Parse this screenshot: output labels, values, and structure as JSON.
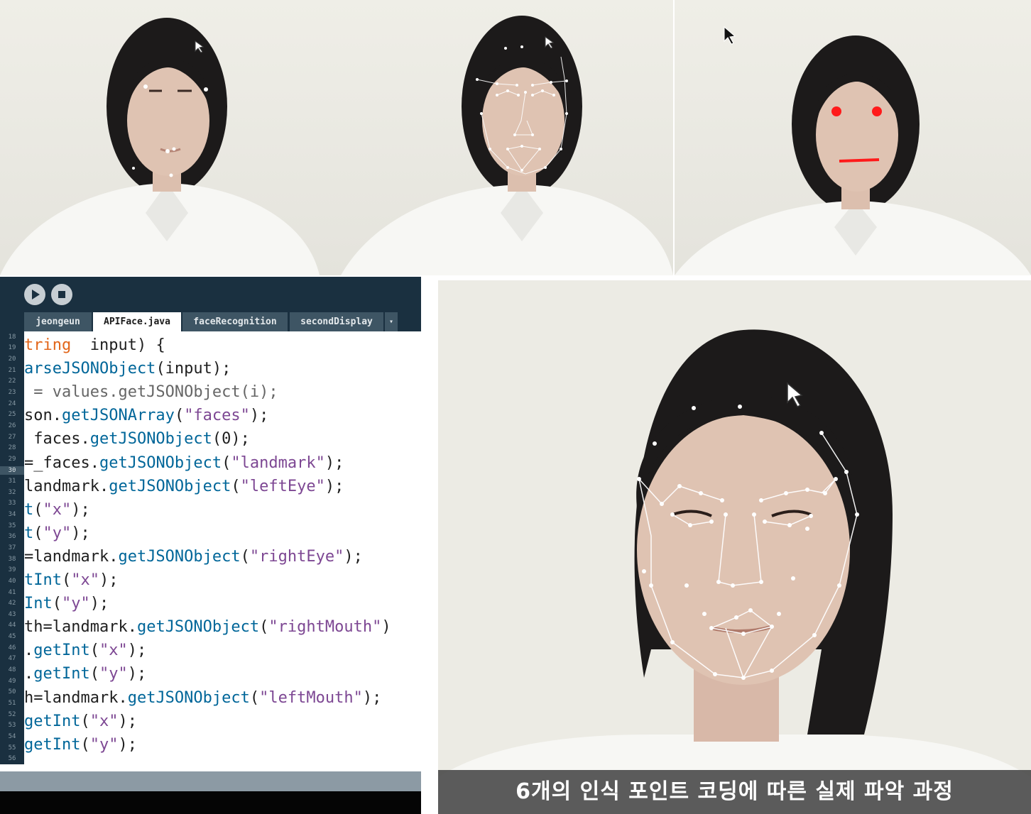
{
  "ide": {
    "toolbar": {
      "run_icon": "play-icon",
      "stop_icon": "stop-icon"
    },
    "tabs": [
      {
        "label": "jeongeun",
        "active": false
      },
      {
        "label": "APIFace.java",
        "active": true
      },
      {
        "label": "faceRecognition",
        "active": false
      },
      {
        "label": "secondDisplay",
        "active": false
      }
    ],
    "tab_menu_glyph": "▾",
    "current_line": 30,
    "line_numbers": [
      "18",
      "19",
      "20",
      "21",
      "22",
      "23",
      "24",
      "25",
      "26",
      "27",
      "28",
      "29",
      "30",
      "31",
      "32",
      "33",
      "34",
      "35",
      "36",
      "37",
      "38",
      "39",
      "40",
      "41",
      "42",
      "43",
      "44",
      "45",
      "46",
      "47",
      "48",
      "49",
      "50",
      "51",
      "52",
      "53",
      "54",
      "55",
      "56"
    ],
    "code": [
      [
        [
          "kw",
          "tring"
        ],
        [
          "",
          "  input) {"
        ]
      ],
      [
        [
          "fn",
          "arseJSONObject"
        ],
        [
          "",
          "(input);"
        ]
      ],
      [
        [
          "dim",
          " = values.getJSONObject(i);"
        ]
      ],
      [
        [
          "",
          "son."
        ],
        [
          "fn",
          "getJSONArray"
        ],
        [
          "",
          "("
        ],
        [
          "str",
          "\"faces\""
        ],
        [
          "",
          ");"
        ]
      ],
      [
        [
          "",
          " faces."
        ],
        [
          "fn",
          "getJSONObject"
        ],
        [
          "",
          "(0);"
        ]
      ],
      [
        [
          "",
          "=_faces."
        ],
        [
          "fn",
          "getJSONObject"
        ],
        [
          "",
          "("
        ],
        [
          "str",
          "\"landmark\""
        ],
        [
          "",
          ");"
        ]
      ],
      [
        [
          "",
          "landmark."
        ],
        [
          "fn",
          "getJSONObject"
        ],
        [
          "",
          "("
        ],
        [
          "str",
          "\"leftEye\""
        ],
        [
          "",
          ");"
        ]
      ],
      [
        [
          "fn",
          "t"
        ],
        [
          "",
          "("
        ],
        [
          "str",
          "\"x\""
        ],
        [
          "",
          ");"
        ]
      ],
      [
        [
          "fn",
          "t"
        ],
        [
          "",
          "("
        ],
        [
          "str",
          "\"y\""
        ],
        [
          "",
          ");"
        ]
      ],
      [
        [
          "",
          "=landmark."
        ],
        [
          "fn",
          "getJSONObject"
        ],
        [
          "",
          "("
        ],
        [
          "str",
          "\"rightEye\""
        ],
        [
          "",
          ");"
        ]
      ],
      [
        [
          "fn",
          "tInt"
        ],
        [
          "",
          "("
        ],
        [
          "str",
          "\"x\""
        ],
        [
          "",
          ");"
        ]
      ],
      [
        [
          "fn",
          "Int"
        ],
        [
          "",
          "("
        ],
        [
          "str",
          "\"y\""
        ],
        [
          "",
          ");"
        ]
      ],
      [
        [
          "",
          "th=landmark."
        ],
        [
          "fn",
          "getJSONObject"
        ],
        [
          "",
          "("
        ],
        [
          "str",
          "\"rightMouth\""
        ],
        [
          "",
          ")"
        ]
      ],
      [
        [
          "",
          "."
        ],
        [
          "fn",
          "getInt"
        ],
        [
          "",
          "("
        ],
        [
          "str",
          "\"x\""
        ],
        [
          "",
          ");"
        ]
      ],
      [
        [
          "",
          "."
        ],
        [
          "fn",
          "getInt"
        ],
        [
          "",
          "("
        ],
        [
          "str",
          "\"y\""
        ],
        [
          "",
          ");"
        ]
      ],
      [
        [
          "",
          "h=landmark."
        ],
        [
          "fn",
          "getJSONObject"
        ],
        [
          "",
          "("
        ],
        [
          "str",
          "\"leftMouth\""
        ],
        [
          "",
          ");"
        ]
      ],
      [
        [
          "fn",
          "getInt"
        ],
        [
          "",
          "("
        ],
        [
          "str",
          "\"x\""
        ],
        [
          "",
          ");"
        ]
      ],
      [
        [
          "fn",
          "getInt"
        ],
        [
          "",
          "("
        ],
        [
          "str",
          "\"y\""
        ],
        [
          "",
          ");"
        ]
      ]
    ]
  },
  "caption": "6개의 인식 포인트 코딩에 따른 실제 파악 과정",
  "colors": {
    "keyword": "#e2661a",
    "function": "#006699",
    "string": "#7d4793",
    "landmark_red": "#ff1a1a",
    "landmark_white": "#ffffff"
  }
}
